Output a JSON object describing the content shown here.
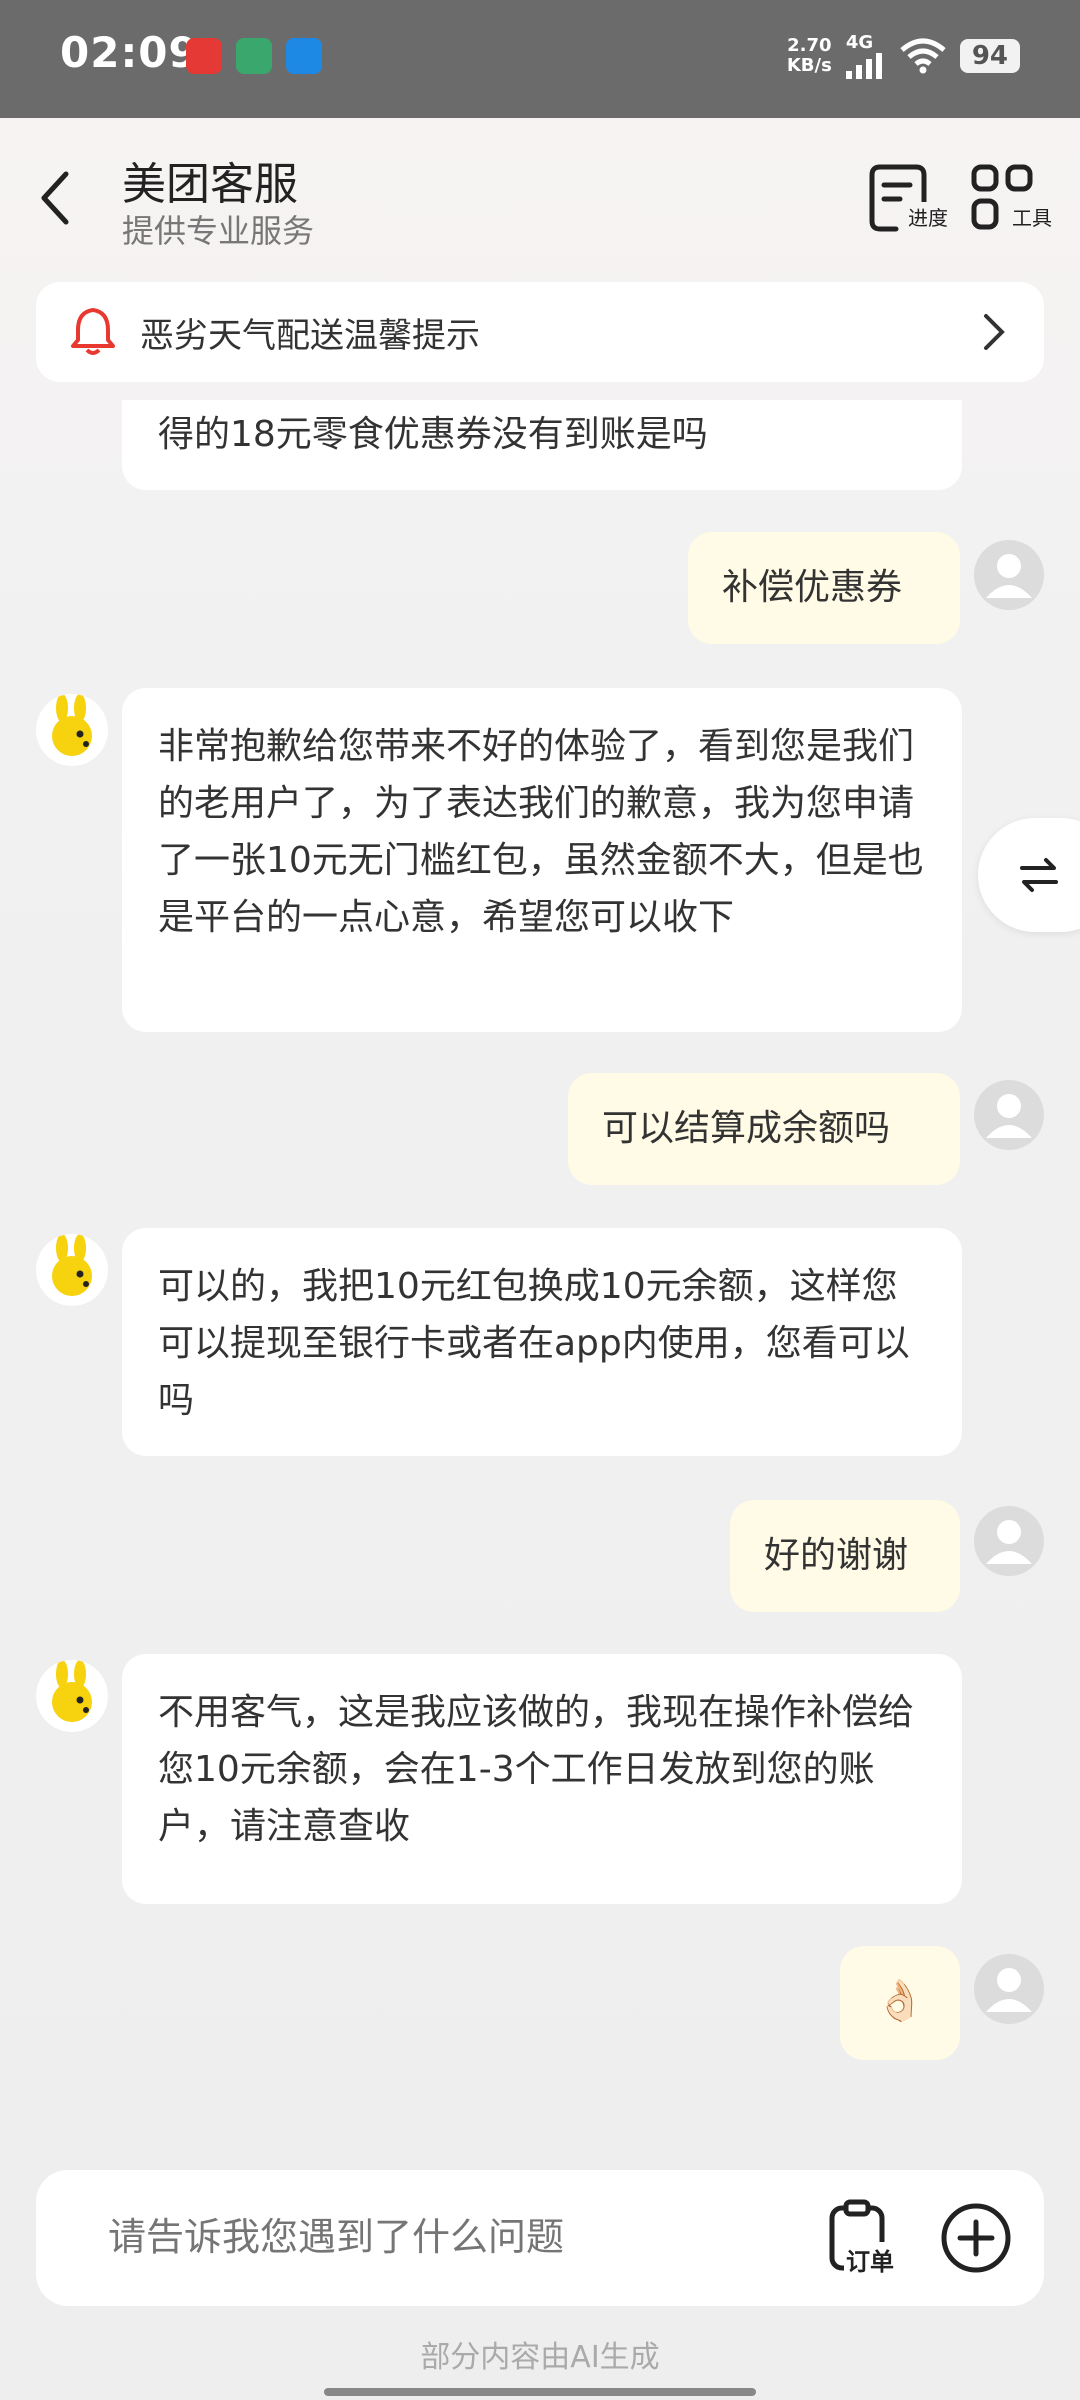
{
  "status_bar": {
    "time": "02:09",
    "speed_value": "2.70",
    "speed_unit": "KB/s",
    "network": "4G",
    "battery": "94"
  },
  "header": {
    "title": "美团客服",
    "subtitle": "提供专业服务",
    "progress_label": "进度",
    "tools_label": "工具"
  },
  "notice": {
    "text": "恶劣天气配送温馨提示"
  },
  "messages": [
    {
      "from": "bot",
      "text": "得的18元零食优惠券没有到账是吗"
    },
    {
      "from": "user",
      "text": "补偿优惠券"
    },
    {
      "from": "bot",
      "text": "非常抱歉给您带来不好的体验了，看到您是我们的老用户了，为了表达我们的歉意，我为您申请了一张10元无门槛红包，虽然金额不大，但是也是平台的一点心意，希望您可以收下"
    },
    {
      "from": "user",
      "text": "可以结算成余额吗"
    },
    {
      "from": "bot",
      "text": "可以的，我把10元红包换成10元余额，这样您可以提现至银行卡或者在app内使用，您看可以吗"
    },
    {
      "from": "user",
      "text": "好的谢谢"
    },
    {
      "from": "bot",
      "text": "不用客气，这是我应该做的，我现在操作补偿给您10元余额，会在1-3个工作日发放到您的账户，请注意查收"
    },
    {
      "from": "user",
      "text": "👌🏻"
    }
  ],
  "composer": {
    "placeholder": "请告诉我您遇到了什么问题",
    "order_label": "订单"
  },
  "footer_note": "部分内容由AI生成",
  "colors": {
    "user_bubble": "#fffbe6",
    "bot_bubble": "#ffffff",
    "alert_red": "#e8382f",
    "mascot_yellow": "#f7d20e"
  }
}
